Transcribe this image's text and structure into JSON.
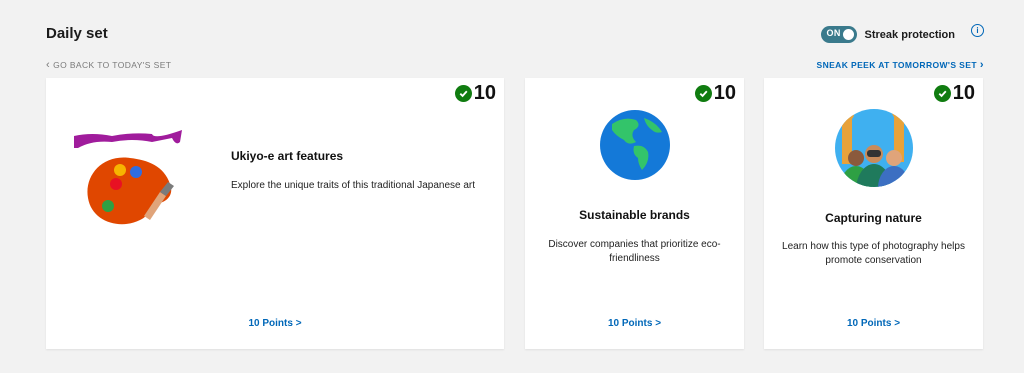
{
  "header": {
    "title": "Daily set",
    "toggle_state": "ON",
    "streak_label": "Streak protection",
    "info_glyph": "i"
  },
  "nav": {
    "back_label": "GO BACK TO TODAY'S SET",
    "forward_label": "SNEAK PEEK AT TOMORROW'S SET"
  },
  "cards": [
    {
      "points": "10",
      "title": "Ukiyo-e art features",
      "description": "Explore the unique traits of this traditional Japanese art",
      "link": "10 Points >",
      "icon": "paint-palette-icon"
    },
    {
      "points": "10",
      "title": "Sustainable brands",
      "description": "Discover companies that prioritize eco-friendliness",
      "link": "10 Points >",
      "icon": "globe-icon"
    },
    {
      "points": "10",
      "title": "Capturing nature",
      "description": "Learn how this type of photography helps promote conservation",
      "link": "10 Points >",
      "icon": "wildlife-photographers-icon"
    }
  ],
  "colors": {
    "accent": "#0067b8",
    "check": "#107c10",
    "toggle": "#3a7a8c"
  }
}
